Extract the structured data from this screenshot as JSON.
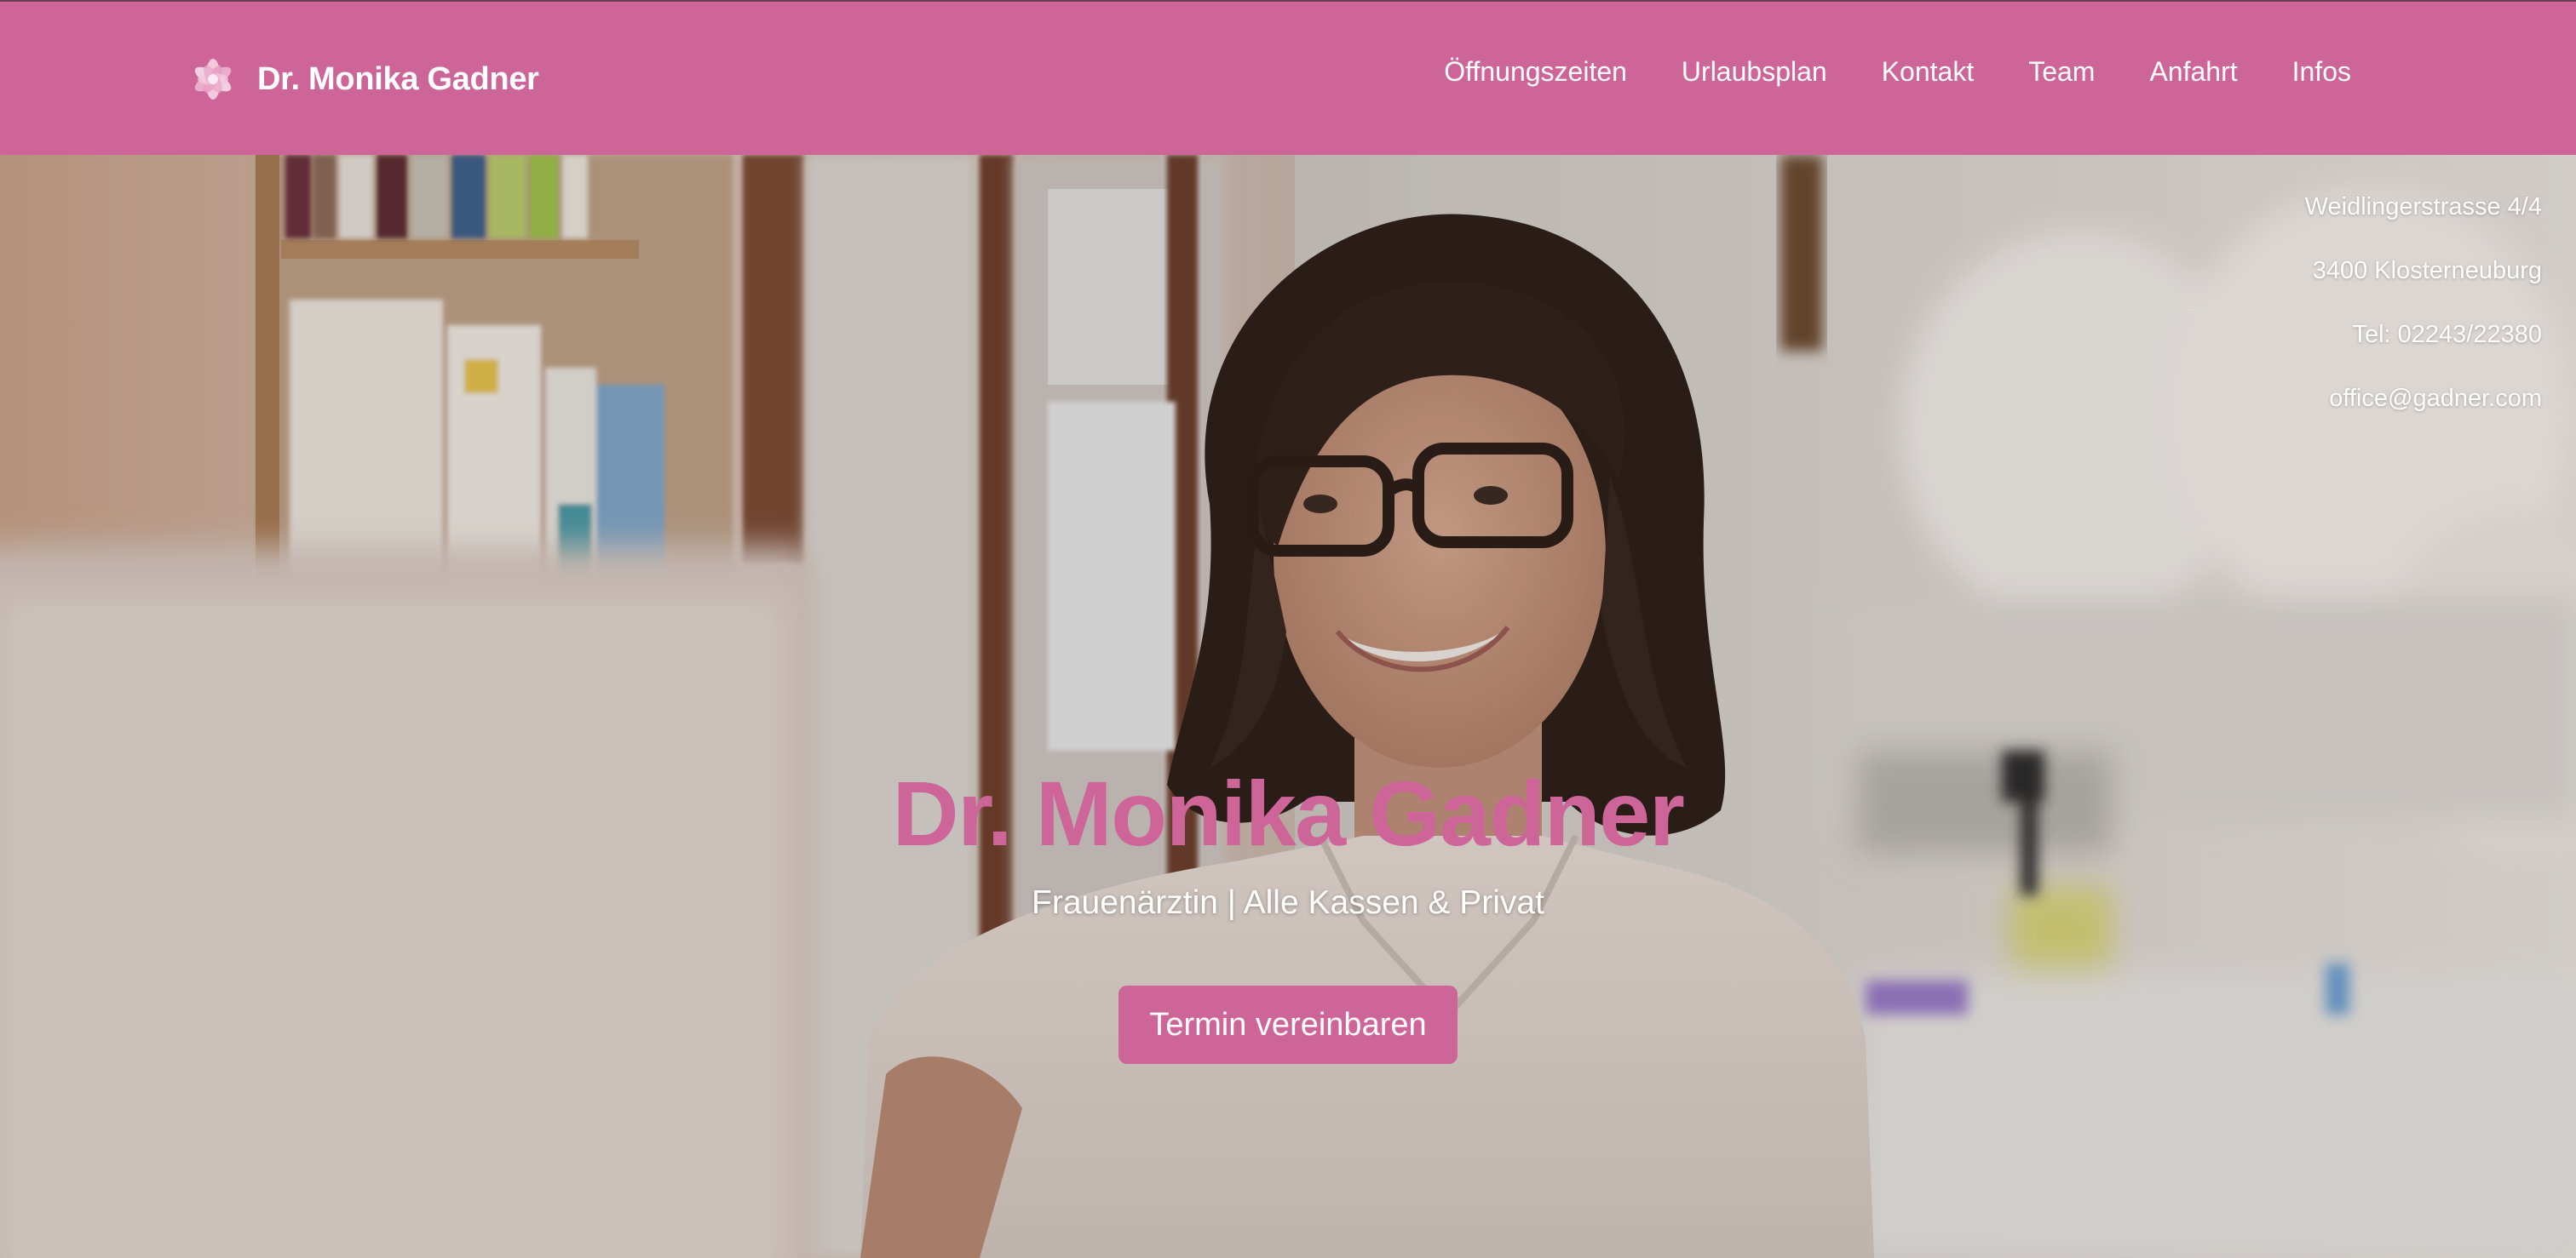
{
  "brand": {
    "name": "Dr. Monika Gadner",
    "logo_icon": "flower-icon"
  },
  "nav": {
    "items": [
      {
        "label": "Öffnungszeiten"
      },
      {
        "label": "Urlaubsplan"
      },
      {
        "label": "Kontakt"
      },
      {
        "label": "Team"
      },
      {
        "label": "Anfahrt"
      },
      {
        "label": "Infos"
      }
    ]
  },
  "contact": {
    "street": "Weidlingerstrasse 4/4",
    "city": "3400 Klosterneuburg",
    "phone": "Tel: 02243/22380",
    "email": "office@gadner.com"
  },
  "hero": {
    "title": "Dr. Monika Gadner",
    "subtitle": "Frauenärztin | Alle Kassen & Privat",
    "cta_label": "Termin vereinbaren",
    "image_icon": "doctor-portrait-photo"
  },
  "colors": {
    "brand_pink": "#cd6599",
    "text_light": "#ffffff"
  }
}
